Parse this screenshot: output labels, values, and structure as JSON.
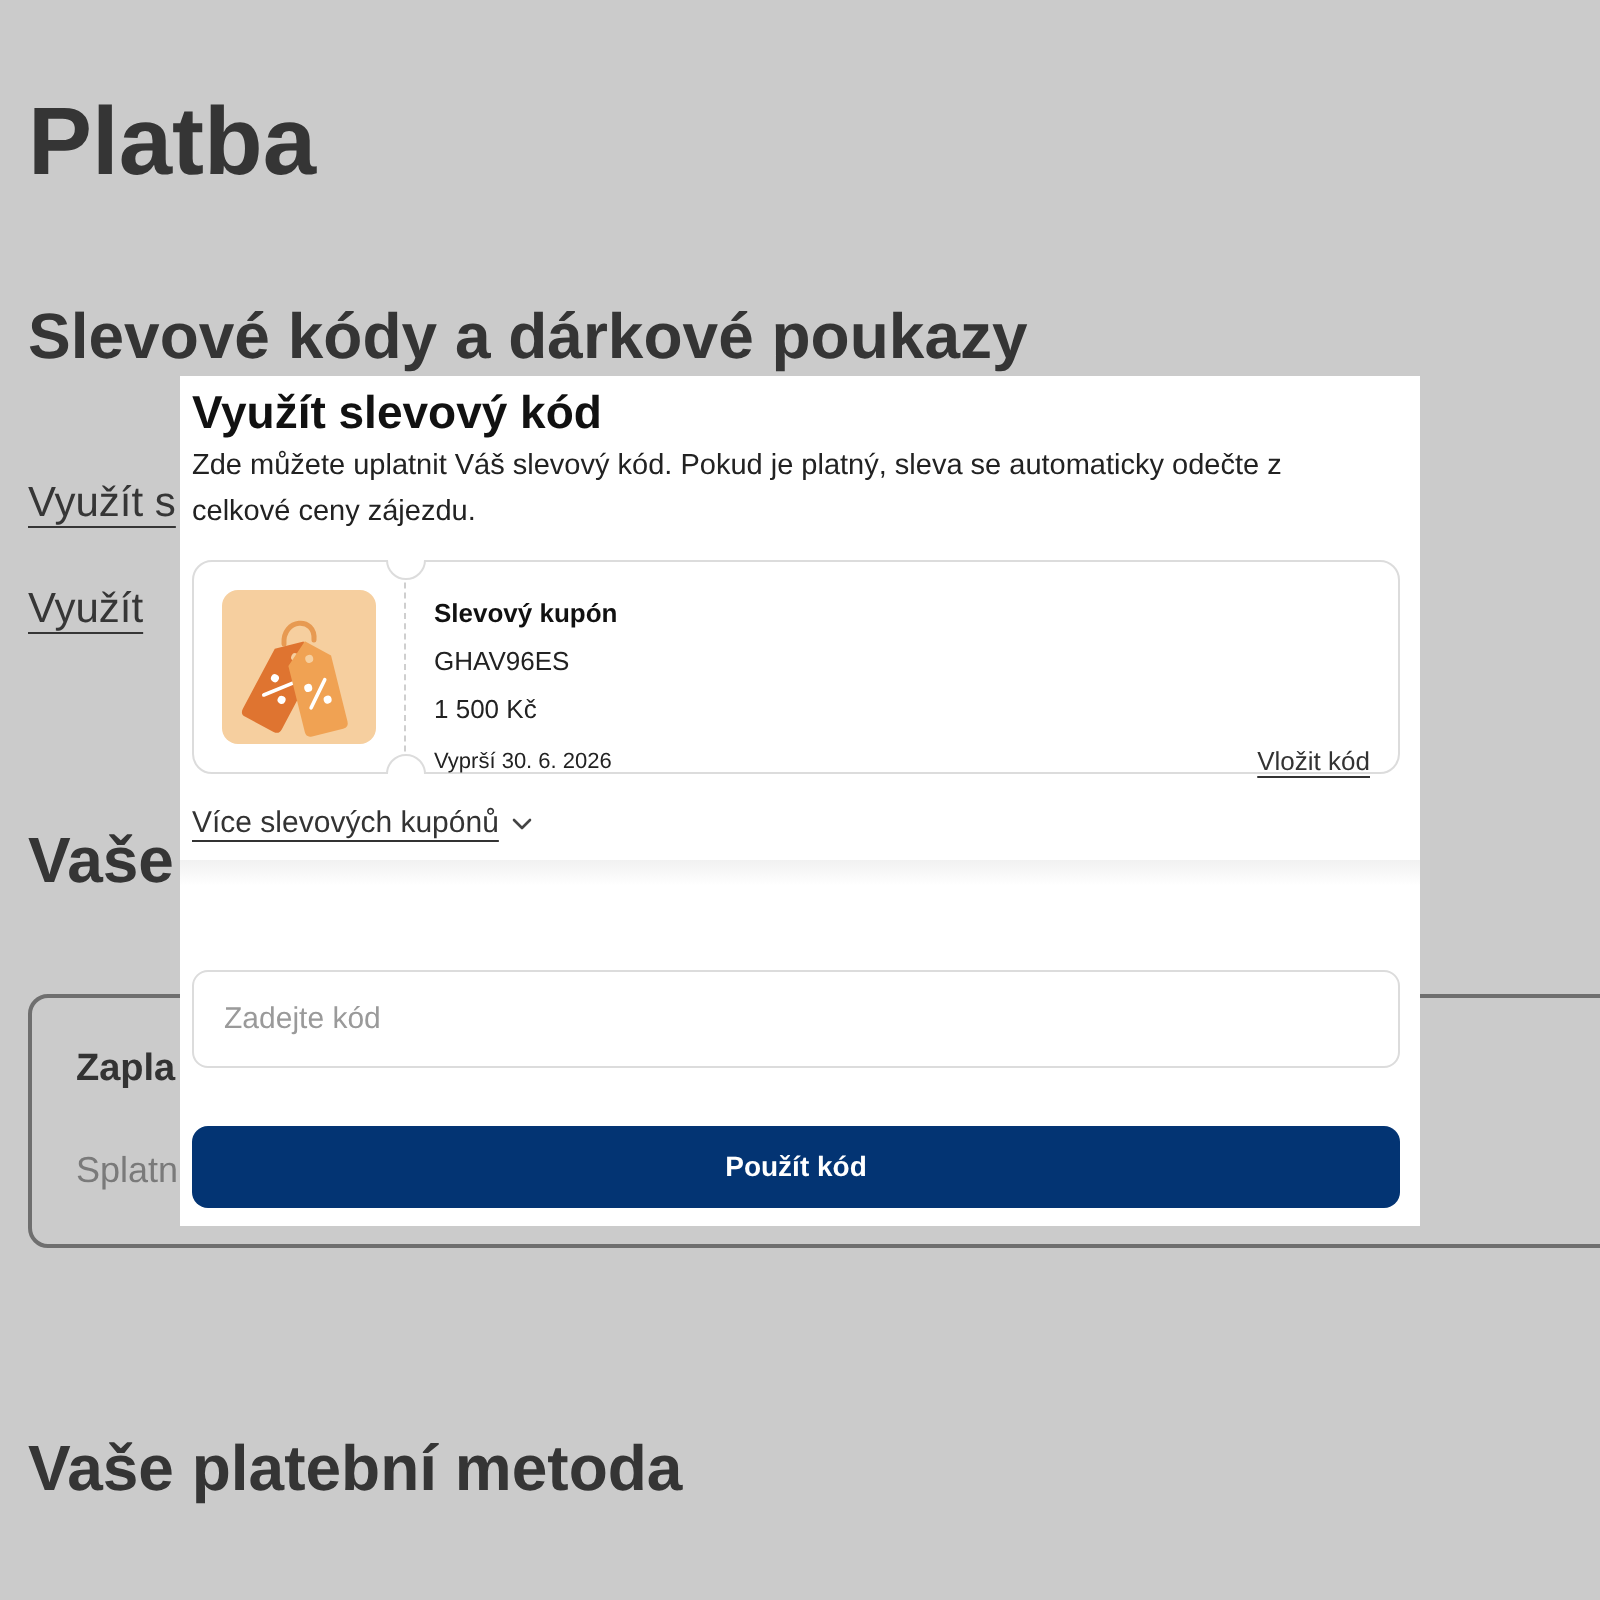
{
  "page_title": "Platba",
  "discounts_section": {
    "heading": "Slevové kódy a dárkové poukazy",
    "links": [
      "Využít s",
      "Využít"
    ]
  },
  "payment_section": {
    "heading": "Vaše",
    "card": {
      "title": "Zapla",
      "text": "Splatn"
    }
  },
  "payment_method_section": {
    "heading": "Vaše platební metoda"
  },
  "modal": {
    "title": "Využít slevový kód",
    "description": "Zde můžete uplatnit Váš slevový kód. Pokud je platný, sleva se automaticky odečte z celkové ceny zájezdu.",
    "coupons": [
      {
        "title": "Slevový kupón",
        "code": "GHAV96ES",
        "amount": "1 500 Kč",
        "expiry": "Vyprší 30. 6. 2026",
        "action": "Vložit kód"
      }
    ],
    "more_coupons": {
      "label": "Více slevových kupónů",
      "expanded": false
    },
    "code_input": {
      "placeholder": "Zadejte kód"
    },
    "submit": "Použít kód"
  }
}
